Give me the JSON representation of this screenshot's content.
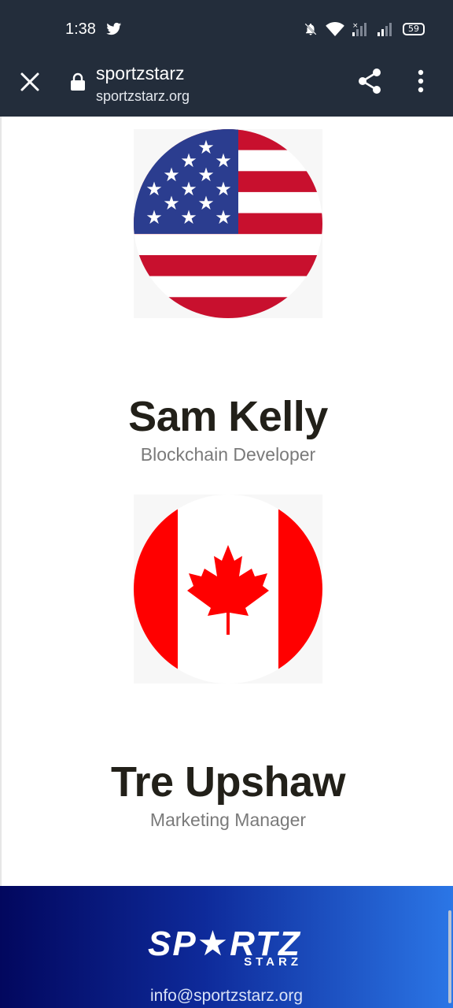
{
  "status_bar": {
    "time": "1:38",
    "battery": "59",
    "icons": [
      "twitter-icon",
      "mute-icon",
      "wifi-icon",
      "signal-icon",
      "signal-icon",
      "battery-icon"
    ]
  },
  "browser": {
    "title": "sportzstarz",
    "url": "sportzstarz.org",
    "icons": [
      "close-icon",
      "lock-icon",
      "share-icon",
      "more-vert-icon"
    ]
  },
  "team": [
    {
      "name": "Sam Kelly",
      "role": "Blockchain Developer",
      "flag": "usa-flag"
    },
    {
      "name": "Tre Upshaw",
      "role": "Marketing Manager",
      "flag": "canada-flag"
    }
  ],
  "footer": {
    "logo_main": "SP★RTZ",
    "logo_sub": "STARZ",
    "email": "info@sportzstarz.org"
  },
  "colors": {
    "header_bg": "#232d3b",
    "us_red": "#c8102e",
    "us_blue": "#2b3d8f",
    "ca_red": "#ff0000",
    "footer_start": "#02075e",
    "footer_end": "#2b76e6"
  }
}
